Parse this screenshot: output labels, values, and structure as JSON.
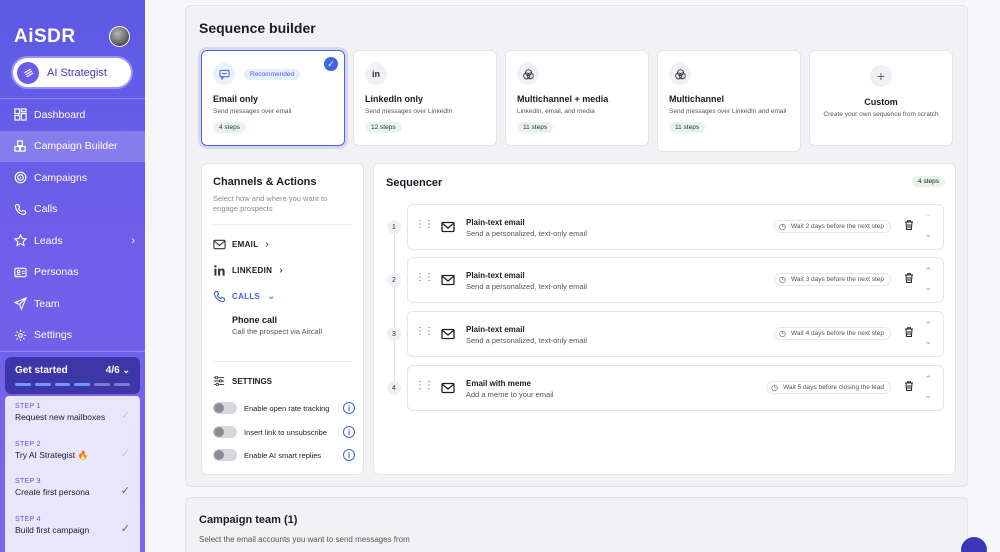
{
  "sidebar": {
    "logo": "AiSDR",
    "strategist_label": "AI Strategist",
    "nav": [
      {
        "label": "Dashboard",
        "icon": "dashboard-icon"
      },
      {
        "label": "Campaign Builder",
        "icon": "blocks-icon",
        "active": true
      },
      {
        "label": "Campaigns",
        "icon": "target-icon"
      },
      {
        "label": "Calls",
        "icon": "phone-icon"
      },
      {
        "label": "Leads",
        "icon": "star-icon",
        "has_chevron": true
      },
      {
        "label": "Personas",
        "icon": "id-card-icon"
      },
      {
        "label": "Team",
        "icon": "send-icon"
      },
      {
        "label": "Settings",
        "icon": "gear-icon"
      }
    ],
    "get_started": {
      "label": "Get started",
      "progress": "4/6",
      "done": 4,
      "total": 6
    },
    "steps": [
      {
        "kicker": "STEP 1",
        "title": "Request new mailboxes",
        "done": false
      },
      {
        "kicker": "STEP 2",
        "title": "Try AI Strategist 🔥",
        "done": false
      },
      {
        "kicker": "STEP 3",
        "title": "Create first persona",
        "done": true
      },
      {
        "kicker": "STEP 4",
        "title": "Build first campaign",
        "done": true
      }
    ]
  },
  "builder": {
    "title": "Sequence builder",
    "cards": [
      {
        "title": "Email only",
        "desc": "Send messages over email",
        "steps": "4 steps",
        "badge": "Recommended",
        "icon": "chat-bubble-icon"
      },
      {
        "title": "LinkedIn only",
        "desc": "Send messages over LinkedIn",
        "steps": "12 steps",
        "icon": "linkedin-icon"
      },
      {
        "title": "Multichannel + media",
        "desc": "LinkedIn, email, and media",
        "steps": "11 steps",
        "icon": "venn-icon"
      },
      {
        "title": "Multichannel",
        "desc": "Send messages over LinkedIn and email",
        "steps": "11 steps",
        "icon": "venn-icon"
      },
      {
        "title": "Custom",
        "desc": "Create your own sequence from scratch",
        "icon": "plus-icon"
      }
    ]
  },
  "channels": {
    "title": "Channels & Actions",
    "subtitle": "Select how and where you want to engage prospects",
    "items": [
      {
        "label": "EMAIL",
        "icon": "mail-icon"
      },
      {
        "label": "LINKEDIN",
        "icon": "linkedin-icon"
      },
      {
        "label": "CALLS",
        "icon": "phone-icon"
      }
    ],
    "phone_call_title": "Phone call",
    "phone_call_desc": "Call the prospect via Aircall",
    "settings_label": "SETTINGS",
    "toggles": [
      {
        "label": "Enable open rate tracking"
      },
      {
        "label": "Insert link to unsubscribe"
      },
      {
        "label": "Enable AI smart replies"
      }
    ]
  },
  "sequencer": {
    "title": "Sequencer",
    "steps_badge": "4 steps",
    "rows": [
      {
        "num": "1",
        "title": "Plain-text email",
        "desc": "Send a personalized, text-only email",
        "wait": "Wait 2 days before the next step"
      },
      {
        "num": "2",
        "title": "Plain-text email",
        "desc": "Send a personalized, text-only email",
        "wait": "Wait 3 days before the next step"
      },
      {
        "num": "3",
        "title": "Plain-text email",
        "desc": "Send a personalized, text-only email",
        "wait": "Wait 4 days before the next step"
      },
      {
        "num": "4",
        "title": "Email with meme",
        "desc": "Add a meme to your email",
        "wait": "Wait 5 days before closing the lead"
      }
    ]
  },
  "team": {
    "title": "Campaign team (1)",
    "desc": "Select the email accounts you want to send messages from"
  }
}
